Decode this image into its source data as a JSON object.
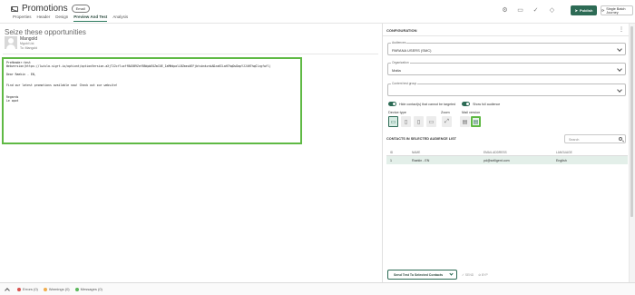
{
  "header": {
    "title": "Promotions",
    "type_badge": "Email",
    "tabs": [
      {
        "label": "Properties",
        "active": false
      },
      {
        "label": "Header",
        "active": false
      },
      {
        "label": "Design",
        "active": false
      },
      {
        "label": "Preview And Test",
        "active": true
      },
      {
        "label": "Analysis",
        "active": false
      }
    ],
    "publish_label": "Publish",
    "journey_label": "Single Batch Journey"
  },
  "preview": {
    "subject": "Seize these opportunities",
    "sender_name": "Mangold",
    "sender_line2": "Mgold Ltd.",
    "sender_line3": "To: Mangold",
    "body": "PreHeader:test\nWebversion(https://lwisla.sigrt.io/optiont/optionVersion.aXjTJ2cfluxffBA5B9Zef8BdpbEOZmIUE_IaMHdpalLBZmeoXEFjbtsbnkznkADza6ILaH7hqDuDapYJJ4H7hqGlzgfwfl)\n\nDear Raekin - EN,\n\n\nFind our latest promotions available now! Check out our website!\n\n\nRegards\nLe opot"
  },
  "config": {
    "title": "CONFIGURATION",
    "audience_label": "Audiences",
    "audience_value": "PARANA USERS (SMC)",
    "organization_label": "Organization",
    "organization_value": "Malta",
    "content_test_label": "Content test group",
    "content_test_value": "",
    "toggle1_label": "Hide contact(s) that cannot be targeted",
    "toggle2_label": "Show full audience",
    "device_type_label": "Device type",
    "zoom_label": "Zoom",
    "mail_version_label": "Mail version",
    "contacts_title": "CONTACTS IN SELECTED AUDIENCE LIST",
    "search_placeholder": "Search",
    "table": {
      "headers": [
        "ID",
        "NAME",
        "EMAIL ADDRESS",
        "LANGUAGE"
      ],
      "rows": [
        [
          "1",
          "Raekin - EN",
          "pd@selligent.com",
          "English"
        ]
      ]
    },
    "send_button": "Send Test To Selected Contacts",
    "mini1": "SEND",
    "mini2": "BYP"
  },
  "footer": {
    "errors": "Errors (0)",
    "warnings": "Warnings (0)",
    "messages": "Messages (0)"
  },
  "colors": {
    "accent": "#2d6b55",
    "highlight": "#5fb944",
    "error": "#d9534f",
    "warning": "#f0ad4e",
    "success": "#5cb85c"
  }
}
